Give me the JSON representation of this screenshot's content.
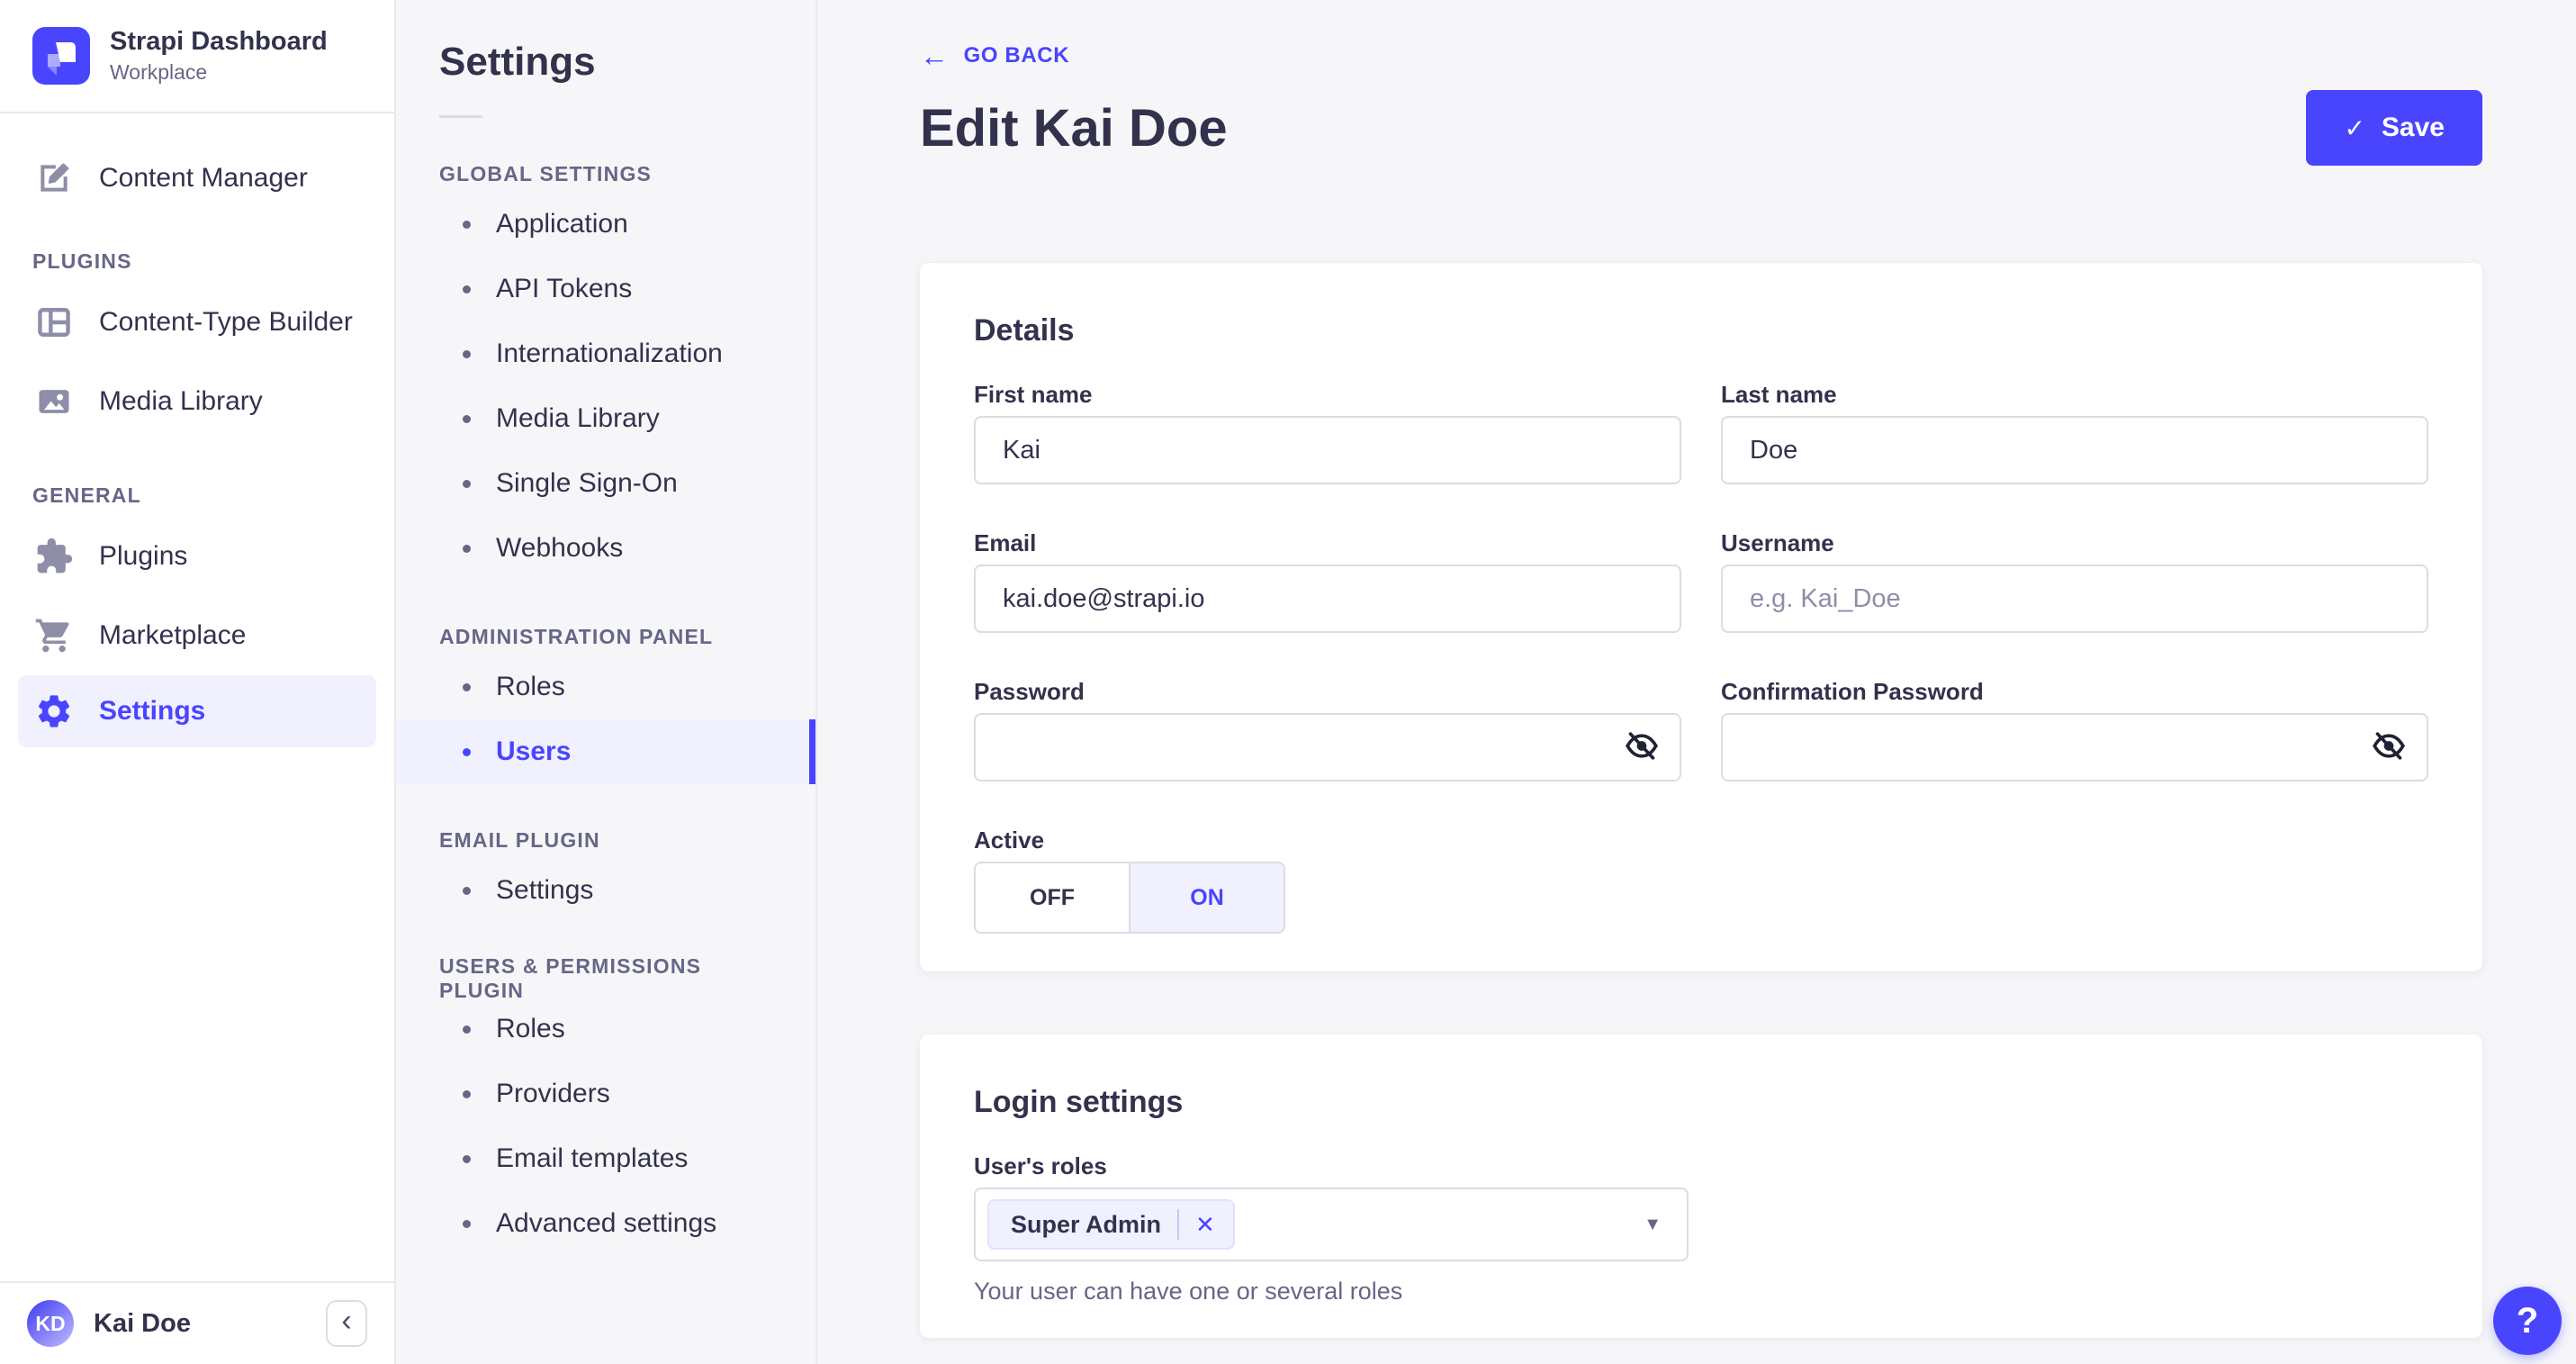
{
  "colors": {
    "accent": "#4945ff",
    "accent_bg": "#f0f0ff",
    "text_dark": "#32324d",
    "text_muted": "#666687",
    "border": "#eaeaef",
    "input_border": "#dcdce4"
  },
  "brand": {
    "title": "Strapi Dashboard",
    "subtitle": "Workplace"
  },
  "primary_nav": {
    "content_manager": "Content Manager",
    "plugins_section": "PLUGINS",
    "content_type_builder": "Content-Type Builder",
    "media_library": "Media Library",
    "general_section": "GENERAL",
    "plugins": "Plugins",
    "marketplace": "Marketplace",
    "settings": "Settings"
  },
  "user": {
    "initials": "KD",
    "name": "Kai Doe"
  },
  "collapse_button": "‹",
  "settings_nav": {
    "title": "Settings",
    "global_section": "GLOBAL SETTINGS",
    "global_items": [
      "Application",
      "API Tokens",
      "Internationalization",
      "Media Library",
      "Single Sign-On",
      "Webhooks"
    ],
    "admin_section": "ADMINISTRATION PANEL",
    "admin_items": [
      "Roles",
      "Users"
    ],
    "email_section": "EMAIL PLUGIN",
    "email_items": [
      "Settings"
    ],
    "up_section": "USERS & PERMISSIONS PLUGIN",
    "up_items": [
      "Roles",
      "Providers",
      "Email templates",
      "Advanced settings"
    ]
  },
  "header": {
    "back": "GO BACK",
    "back_arrow": "←",
    "title": "Edit Kai Doe",
    "save": "Save",
    "save_check": "✓"
  },
  "details_card": {
    "heading": "Details",
    "first_name": {
      "label": "First name",
      "value": "Kai"
    },
    "last_name": {
      "label": "Last name",
      "value": "Doe"
    },
    "email": {
      "label": "Email",
      "value": "kai.doe@strapi.io"
    },
    "username": {
      "label": "Username",
      "placeholder": "e.g. Kai_Doe"
    },
    "password": {
      "label": "Password"
    },
    "confirmation_password": {
      "label": "Confirmation Password"
    },
    "active": {
      "label": "Active",
      "off": "OFF",
      "on": "ON",
      "value": "ON"
    }
  },
  "login_card": {
    "heading": "Login settings",
    "roles_label": "User's roles",
    "role_tag": "Super Admin",
    "remove_tag": "✕",
    "caret": "▼",
    "hint": "Your user can have one or several roles"
  },
  "help": "?"
}
